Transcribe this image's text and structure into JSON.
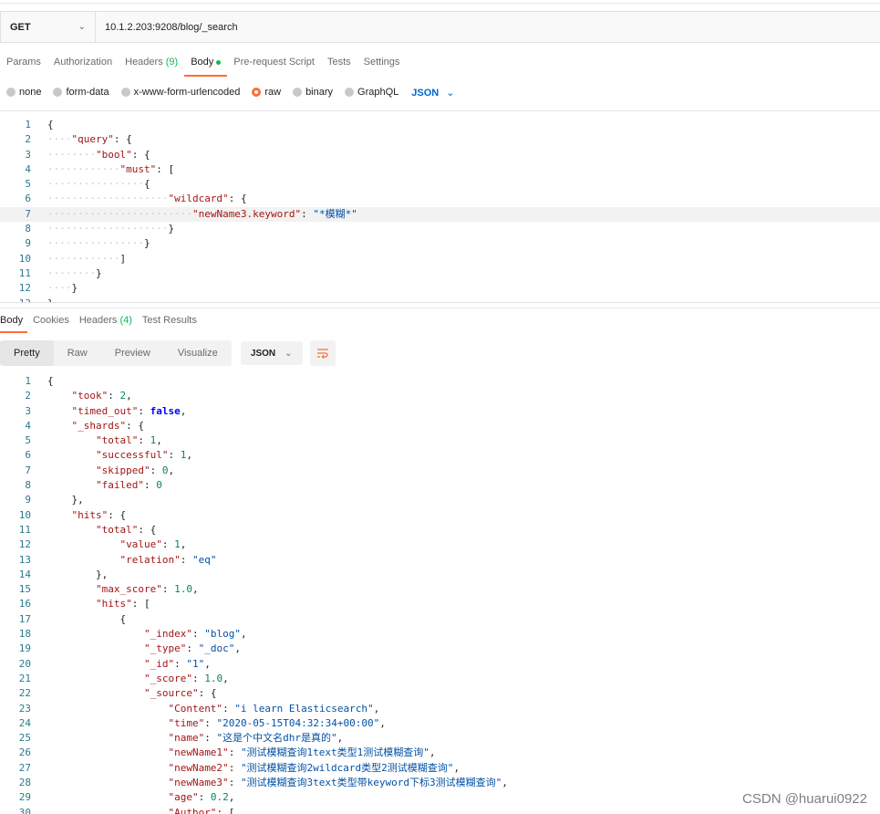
{
  "request": {
    "method": "GET",
    "url": "10.1.2.203:9208/blog/_search",
    "tabs": [
      {
        "label": "Params"
      },
      {
        "label": "Authorization"
      },
      {
        "label": "Headers ",
        "count": "(9)"
      },
      {
        "label": "Body"
      },
      {
        "label": "Pre-request Script"
      },
      {
        "label": "Tests"
      },
      {
        "label": "Settings"
      }
    ],
    "body_types": [
      "none",
      "form-data",
      "x-www-form-urlencoded",
      "raw",
      "binary",
      "GraphQL"
    ],
    "body_types_selected": "raw",
    "format": "JSON",
    "accent_color": "#ff6c37"
  },
  "request_body_lines": [
    {
      "n": "1",
      "t": "{"
    },
    {
      "n": "2",
      "t": "····\"query\": {"
    },
    {
      "n": "3",
      "t": "········\"bool\": {"
    },
    {
      "n": "4",
      "t": "············\"must\": ["
    },
    {
      "n": "5",
      "t": "················{"
    },
    {
      "n": "6",
      "t": "····················\"wildcard\": {"
    },
    {
      "n": "7",
      "t": "························\"newName3.keyword\": \"*模糊*\""
    },
    {
      "n": "8",
      "t": "····················}"
    },
    {
      "n": "9",
      "t": "················}"
    },
    {
      "n": "10",
      "t": "············]"
    },
    {
      "n": "11",
      "t": "········}"
    },
    {
      "n": "12",
      "t": "····}"
    },
    {
      "n": "13",
      "t": "}"
    }
  ],
  "response": {
    "tabs": [
      {
        "label": "Body"
      },
      {
        "label": "Cookies"
      },
      {
        "label": "Headers ",
        "count": "(4)"
      },
      {
        "label": "Test Results"
      }
    ],
    "views": [
      "Pretty",
      "Raw",
      "Preview",
      "Visualize"
    ],
    "format": "JSON"
  },
  "response_body_lines": [
    {
      "n": "1",
      "t": "{"
    },
    {
      "n": "2",
      "t": "    \"took\": 2,"
    },
    {
      "n": "3",
      "t": "    \"timed_out\": false,"
    },
    {
      "n": "4",
      "t": "    \"_shards\": {"
    },
    {
      "n": "5",
      "t": "        \"total\": 1,"
    },
    {
      "n": "6",
      "t": "        \"successful\": 1,"
    },
    {
      "n": "7",
      "t": "        \"skipped\": 0,"
    },
    {
      "n": "8",
      "t": "        \"failed\": 0"
    },
    {
      "n": "9",
      "t": "    },"
    },
    {
      "n": "10",
      "t": "    \"hits\": {"
    },
    {
      "n": "11",
      "t": "        \"total\": {"
    },
    {
      "n": "12",
      "t": "            \"value\": 1,"
    },
    {
      "n": "13",
      "t": "            \"relation\": \"eq\""
    },
    {
      "n": "14",
      "t": "        },"
    },
    {
      "n": "15",
      "t": "        \"max_score\": 1.0,"
    },
    {
      "n": "16",
      "t": "        \"hits\": ["
    },
    {
      "n": "17",
      "t": "            {"
    },
    {
      "n": "18",
      "t": "                \"_index\": \"blog\","
    },
    {
      "n": "19",
      "t": "                \"_type\": \"_doc\","
    },
    {
      "n": "20",
      "t": "                \"_id\": \"1\","
    },
    {
      "n": "21",
      "t": "                \"_score\": 1.0,"
    },
    {
      "n": "22",
      "t": "                \"_source\": {"
    },
    {
      "n": "23",
      "t": "                    \"Content\": \"i learn Elasticsearch\","
    },
    {
      "n": "24",
      "t": "                    \"time\": \"2020-05-15T04:32:34+00:00\","
    },
    {
      "n": "25",
      "t": "                    \"name\": \"这是个中文名dhr是真的\","
    },
    {
      "n": "26",
      "t": "                    \"newName1\": \"测试模糊查询1text类型1测试模糊查询\","
    },
    {
      "n": "27",
      "t": "                    \"newName2\": \"测试模糊查询2wildcard类型2测试模糊查询\","
    },
    {
      "n": "28",
      "t": "                    \"newName3\": \"测试模糊查询3text类型带keyword下标3测试模糊查询\","
    },
    {
      "n": "29",
      "t": "                    \"age\": 0.2,"
    },
    {
      "n": "30",
      "t": "                    \"Author\": ["
    }
  ],
  "watermark": "CSDN @huarui0922"
}
